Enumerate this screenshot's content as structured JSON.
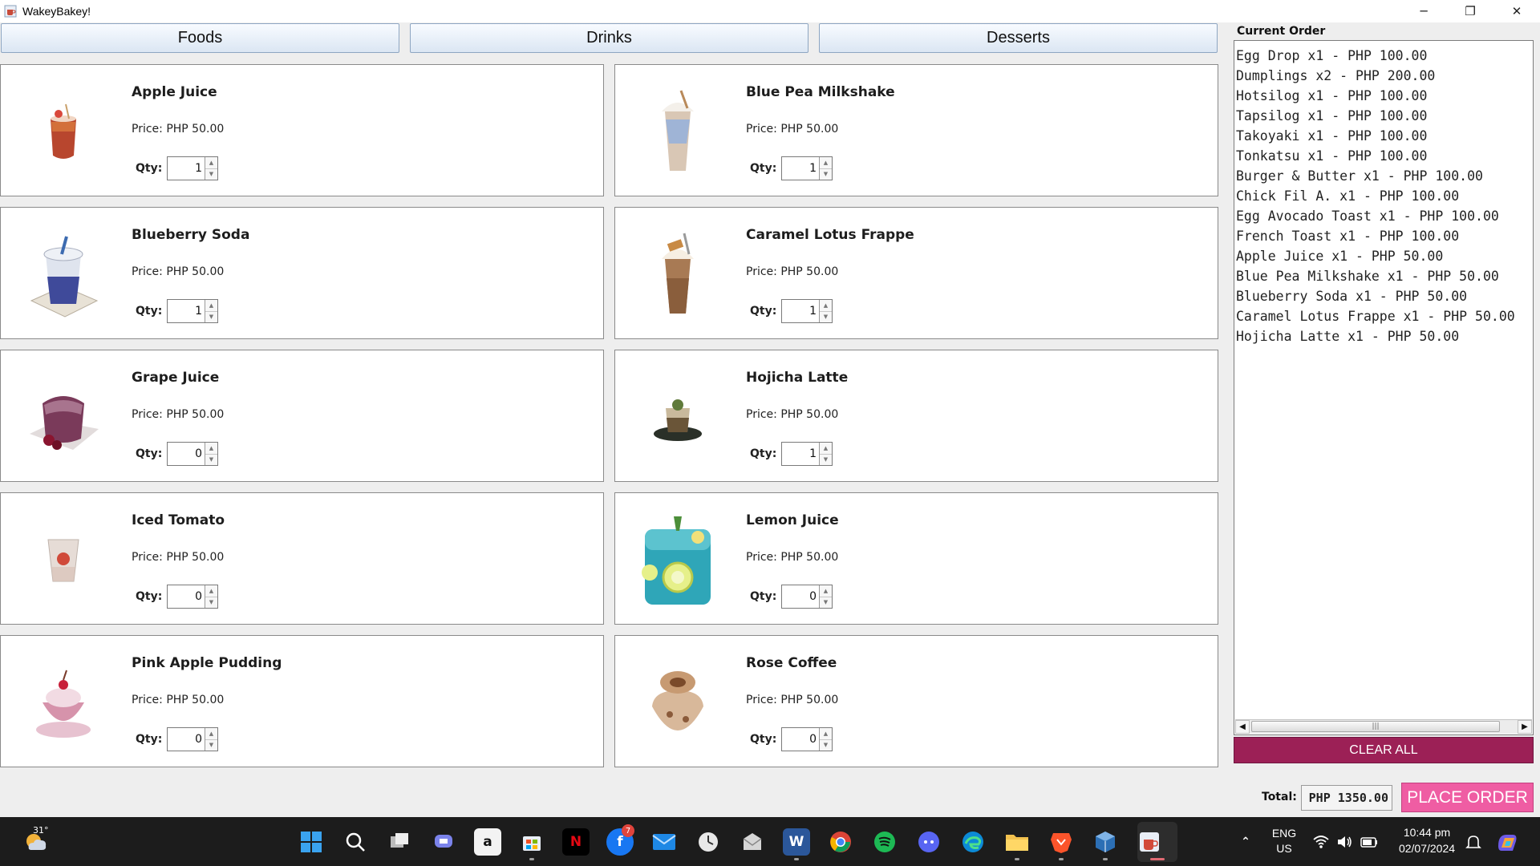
{
  "window": {
    "title": "WakeyBakey!",
    "controls": {
      "minimize": "─",
      "maximize": "❐",
      "close": "✕"
    }
  },
  "categories": [
    {
      "label": "Foods"
    },
    {
      "label": "Drinks"
    },
    {
      "label": "Desserts"
    }
  ],
  "qty_label": "Qty:",
  "items": [
    {
      "name": "Apple Juice",
      "price": "Price: PHP 50.00",
      "qty": "1",
      "image": "apple-juice-photo"
    },
    {
      "name": "Blue Pea Milkshake",
      "price": "Price: PHP 50.00",
      "qty": "1",
      "image": "milkshake-photo"
    },
    {
      "name": "Blueberry Soda",
      "price": "Price: PHP 50.00",
      "qty": "1",
      "image": "blueberry-soda-photo"
    },
    {
      "name": "Caramel Lotus Frappe",
      "price": "Price: PHP 50.00",
      "qty": "1",
      "image": "frappe-photo"
    },
    {
      "name": "Grape Juice",
      "price": "Price: PHP 50.00",
      "qty": "0",
      "image": "grape-juice-photo"
    },
    {
      "name": "Hojicha Latte",
      "price": "Price: PHP 50.00",
      "qty": "1",
      "image": "latte-photo"
    },
    {
      "name": "Iced Tomato",
      "price": "Price: PHP 50.00",
      "qty": "0",
      "image": "iced-tomato-photo"
    },
    {
      "name": "Lemon Juice",
      "price": "Price: PHP 50.00",
      "qty": "0",
      "image": "lemon-juice-photo"
    },
    {
      "name": "Pink Apple Pudding",
      "price": "Price: PHP 50.00",
      "qty": "0",
      "image": "pudding-photo"
    },
    {
      "name": "Rose Coffee",
      "price": "Price: PHP 50.00",
      "qty": "0",
      "image": "rose-coffee-photo"
    }
  ],
  "order": {
    "title": "Current Order",
    "lines": [
      "Egg Drop x1 - PHP 100.00",
      "Dumplings x2 - PHP 200.00",
      "Hotsilog x1 - PHP 100.00",
      "Tapsilog x1 - PHP 100.00",
      "Takoyaki x1 - PHP 100.00",
      "Tonkatsu x1 - PHP 100.00",
      "Burger & Butter x1 - PHP 100.00",
      "Chick Fil A. x1 - PHP 100.00",
      "Egg Avocado Toast x1 - PHP 100.00",
      "French Toast x1 - PHP 100.00",
      "Apple Juice x1 - PHP 50.00",
      "Blue Pea Milkshake x1 - PHP 50.00",
      "Blueberry Soda x1 - PHP 50.00",
      "Caramel Lotus Frappe x1 - PHP 50.00",
      "Hojicha Latte x1 - PHP 50.00"
    ]
  },
  "clear_label": "CLEAR ALL",
  "total": {
    "label": "Total:",
    "value": "PHP 1350.00"
  },
  "place_label": "PLACE ORDER",
  "colors": {
    "clear": "#9c2056",
    "place": "#ef5da3",
    "taskbar": "#1c1c1c"
  },
  "taskbar": {
    "weather_temp": "31°",
    "facebook_badge": "7",
    "lang": "ENG",
    "region": "US",
    "time": "10:44 pm",
    "date": "02/07/2024",
    "apps": [
      "windows-start-icon",
      "search-icon",
      "task-view-icon",
      "teams-chat-icon",
      "amazon-icon",
      "microsoft-store-icon",
      "netflix-icon",
      "facebook-icon",
      "mail-icon",
      "clock-icon",
      "mailbox-icon",
      "word-icon",
      "chrome-icon",
      "spotify-icon",
      "discord-icon",
      "edge-icon",
      "file-explorer-icon",
      "brave-icon",
      "virtual-box-icon",
      "java-app-icon"
    ]
  }
}
